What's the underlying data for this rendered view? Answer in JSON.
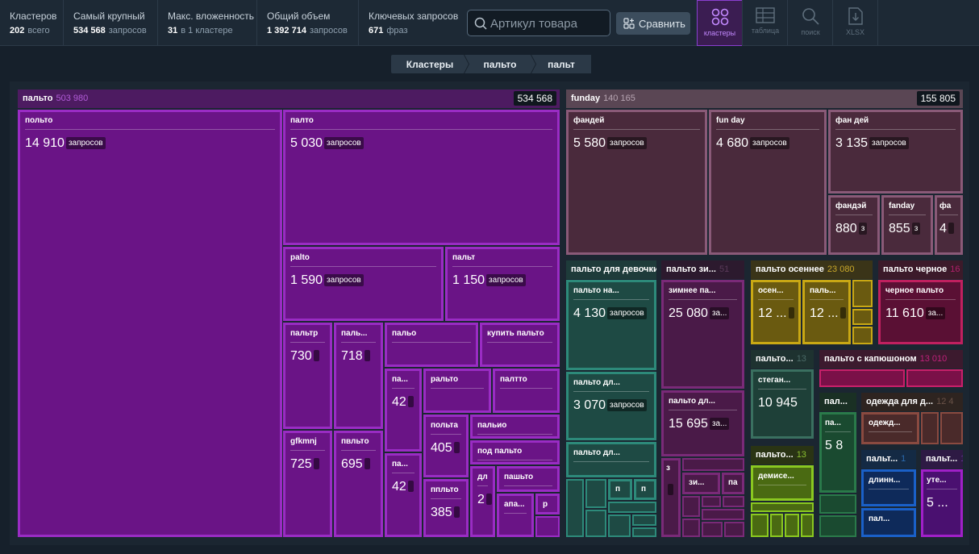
{
  "stats": {
    "clusters": {
      "label": "Кластеров",
      "value": "202",
      "unit": "всего"
    },
    "largest": {
      "label": "Самый крупный",
      "value": "534 568",
      "unit": "запросов"
    },
    "max_nesting": {
      "label": "Макс. вложенность",
      "value": "31",
      "unit": "в 1 кластере"
    },
    "total_volume": {
      "label": "Общий объем",
      "value": "1 392 714",
      "unit": "запросов"
    },
    "keywords": {
      "label": "Ключевых запросов",
      "value": "671",
      "unit": "фраз"
    }
  },
  "search": {
    "placeholder": "Артикул товара",
    "value": ""
  },
  "compare_label": "Сравнить",
  "views": {
    "clusters": "кластеры",
    "table": "таблица",
    "search": "поиск",
    "xlsx": "XLSX",
    "active": "clusters"
  },
  "breadcrumbs": [
    "Кластеры",
    "пальто",
    "пальт"
  ],
  "unit": "запросов",
  "colors": {
    "accent": "#8a3fd0",
    "purple_fill": "#6a1486",
    "purple_border": "#9a2cc4",
    "funday_fill": "#4a2a3c",
    "funday_border": "#8a5a78"
  },
  "groups": {
    "palto": {
      "title": "пальто",
      "sub": "503 980",
      "total": "534 568"
    },
    "funday": {
      "title": "funday",
      "sub": "140 165",
      "total": "155 805"
    },
    "devochki": {
      "title": "пальто для девочки"
    },
    "zimnee": {
      "title": "пальто зи...",
      "sub": "51"
    },
    "osennee": {
      "title": "пальто осеннее",
      "sub": "23 080"
    },
    "chernoe": {
      "title": "пальто черное",
      "sub": "16"
    },
    "p13a": {
      "title": "пальто...",
      "sub": "13"
    },
    "kapushon": {
      "title": "пальто с капюшоном",
      "sub": "13 010"
    },
    "odezhda": {
      "title": "одежда для д...",
      "sub": "12 4"
    },
    "p13b": {
      "title": "пальто...",
      "sub": "13"
    },
    "pal_s": {
      "title": "пал..."
    },
    "palt_b": {
      "title": "пальт...",
      "sub": "1"
    },
    "palt_v": {
      "title": "пальт...",
      "sub": "1"
    }
  },
  "nodes": {
    "polto": {
      "title": "польто",
      "num": "14 910"
    },
    "palto2": {
      "title": "палто",
      "num": "5 030"
    },
    "palto_lat": {
      "title": "palto",
      "num": "1 590"
    },
    "palt": {
      "title": "пальт",
      "num": "1 150"
    },
    "paltr": {
      "title": "пальтр",
      "num": "730"
    },
    "pal_a": {
      "title": "паль...",
      "num": "718"
    },
    "palo": {
      "title": "пальо",
      "num": ""
    },
    "kupit": {
      "title": "купить пальто",
      "num": ""
    },
    "pa1": {
      "title": "па...",
      "num": "42"
    },
    "ralto": {
      "title": "ральто",
      "num": ""
    },
    "paltto": {
      "title": "палтто",
      "num": ""
    },
    "gfkmnj": {
      "title": "gfkmnj",
      "num": "725"
    },
    "pvlto": {
      "title": "пвльто",
      "num": "695"
    },
    "pa2": {
      "title": "па...",
      "num": "42"
    },
    "polta": {
      "title": "польта",
      "num": "405"
    },
    "palio": {
      "title": "пальио",
      "num": ""
    },
    "podpalto": {
      "title": "под пальто",
      "num": ""
    },
    "pplto": {
      "title": "ппльто",
      "num": "385"
    },
    "dl": {
      "title": "дл",
      "num": "2"
    },
    "pashto": {
      "title": "пашьто",
      "num": ""
    },
    "apa": {
      "title": "апа...",
      "num": ""
    },
    "r": {
      "title": "р",
      "num": ""
    },
    "fandey": {
      "title": "фандей",
      "num": "5 580"
    },
    "funday_sp": {
      "title": "fun day",
      "num": "4 680"
    },
    "fan_dey": {
      "title": "фан дей",
      "num": "3 135"
    },
    "fandzey": {
      "title": "фандэй",
      "num": "880"
    },
    "funday_l": {
      "title": "fanday",
      "num": "855"
    },
    "fa": {
      "title": "фа",
      "num": "4"
    },
    "na": {
      "title": "пальто на...",
      "num": "4 130"
    },
    "dl1": {
      "title": "пальто дл...",
      "num": "3 070"
    },
    "dl2": {
      "title": "пальто дл...",
      "num": ""
    },
    "zimnee_pa": {
      "title": "зимнее па...",
      "num": "25 080"
    },
    "dl3": {
      "title": "пальто дл...",
      "num": "15 695"
    },
    "z": {
      "title": "з",
      "num": ""
    },
    "zi": {
      "title": "зи...",
      "num": ""
    },
    "pa3": {
      "title": "па",
      "num": ""
    },
    "osen": {
      "title": "осен...",
      "num": "12 ..."
    },
    "palt_o": {
      "title": "паль...",
      "num": "12 ..."
    },
    "chernoe_p": {
      "title": "черное пальто",
      "num": "11 610"
    },
    "stegan": {
      "title": "стеган...",
      "num": "10 945"
    },
    "pa_s": {
      "title": "па...",
      "num": "5 8"
    },
    "odezhd": {
      "title": "одежд...",
      "num": ""
    },
    "demise": {
      "title": "демисе...",
      "num": ""
    },
    "dlinn": {
      "title": "длинн...",
      "num": ""
    },
    "pal_i": {
      "title": "пал...",
      "num": ""
    },
    "ute": {
      "title": "уте...",
      "num": "5 ..."
    },
    "p_a": {
      "title": "п",
      "num": ""
    },
    "p_b": {
      "title": "п",
      "num": ""
    }
  }
}
